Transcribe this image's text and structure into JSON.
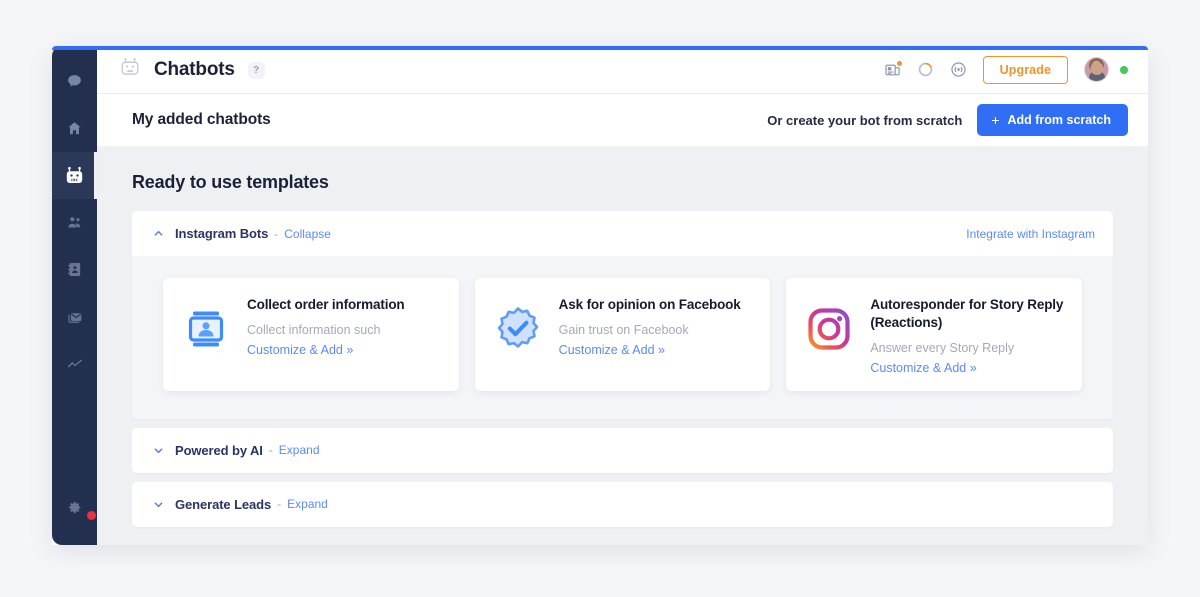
{
  "window": {
    "accent_blue": "#2f6ef5",
    "sidebar_bg": "#232f4e"
  },
  "sidebar": {
    "items": [
      {
        "name": "chat",
        "icon": "chat-bubble-icon",
        "active": false
      },
      {
        "name": "home",
        "icon": "home-icon",
        "active": false
      },
      {
        "name": "chatbots",
        "icon": "robot-icon",
        "active": true
      },
      {
        "name": "audience",
        "icon": "users-icon",
        "active": false
      },
      {
        "name": "contacts",
        "icon": "address-book-icon",
        "active": false
      },
      {
        "name": "messages",
        "icon": "envelope-icon",
        "active": false
      },
      {
        "name": "analytics",
        "icon": "line-chart-icon",
        "active": false
      }
    ],
    "bottom": {
      "name": "settings",
      "icon": "gear-icon",
      "badge_color": "#e8333c"
    }
  },
  "topbar": {
    "title": "Chatbots",
    "help_badge": "?",
    "icons": [
      {
        "name": "news-icon",
        "badge": true,
        "badge_color": "#f79232"
      },
      {
        "name": "loading-spinner-icon",
        "color": "#f79232"
      },
      {
        "name": "broadcast-icon",
        "color": "#8e98ad"
      }
    ],
    "upgrade_label": "Upgrade",
    "upgrade_color": "#f0932b",
    "status_color": "#45c759"
  },
  "subbar": {
    "title": "My added chatbots",
    "scratch_hint": "Or create your bot from scratch",
    "add_button_label": "Add from scratch",
    "add_button_plus": "+",
    "add_button_color": "#2f6ef5"
  },
  "content": {
    "section_title": "Ready to use templates",
    "panels": [
      {
        "name": "Instagram Bots",
        "separator": "-",
        "toggle_label": "Collapse",
        "expanded": true,
        "right_link": "Integrate with Instagram",
        "chevron": "up",
        "cards": [
          {
            "icon": "id-card-icon",
            "title": "Collect order information",
            "description": "Collect information such",
            "cta": "Customize & Add »"
          },
          {
            "icon": "verified-badge-icon",
            "title": "Ask for opinion on Facebook",
            "description": "Gain trust on Facebook",
            "cta": "Customize & Add »"
          },
          {
            "icon": "instagram-icon",
            "title": "Autoresponder for Story Reply (Reactions)",
            "description": "Answer every Story Reply",
            "cta": "Customize & Add »"
          }
        ]
      },
      {
        "name": "Powered by AI",
        "separator": "-",
        "toggle_label": "Expand",
        "expanded": false,
        "right_link": "",
        "chevron": "down",
        "cards": []
      },
      {
        "name": "Generate Leads",
        "separator": "-",
        "toggle_label": "Expand",
        "expanded": false,
        "right_link": "",
        "chevron": "down",
        "cards": []
      }
    ]
  }
}
